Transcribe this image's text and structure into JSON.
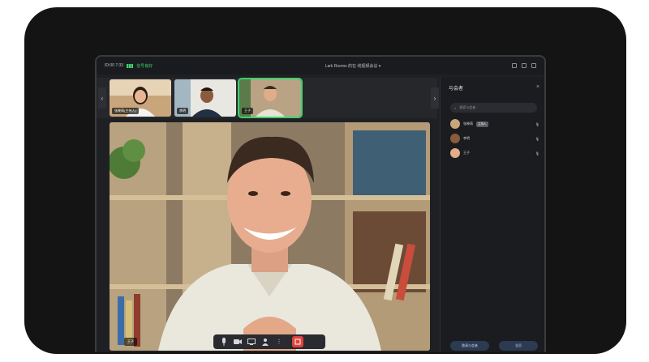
{
  "titlebar": {
    "left_info": "ID:00 7:33",
    "network": "信号良好",
    "meeting_title": "Lark Rooms 的在 线视频会议",
    "colors": {
      "network": "#3bd16f"
    }
  },
  "thumbnails": [
    {
      "name": "张晓萌(主持人)",
      "icon": "person-thumb"
    },
    {
      "name": "李明",
      "icon": "person-thumb"
    },
    {
      "name": "王子",
      "icon": "person-thumb"
    }
  ],
  "main_video": {
    "speaker": "王子"
  },
  "controls": {
    "items": [
      "mic-icon",
      "camera-icon",
      "share-screen-icon",
      "participants-icon",
      "more-icon"
    ],
    "end_label": "end-call-icon",
    "colors": {
      "end": "#e0433b"
    }
  },
  "panel": {
    "title": "与会者",
    "search_placeholder": "搜索与会者",
    "members": [
      {
        "name": "张晓萌",
        "badge": "主持人"
      },
      {
        "name": "李明",
        "badge": ""
      },
      {
        "name": "王子",
        "badge": ""
      }
    ],
    "buttons": {
      "invite": "邀请与会者",
      "mute_all": "全员"
    }
  }
}
